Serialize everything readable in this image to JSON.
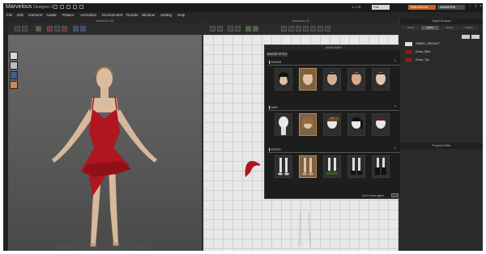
{
  "app": {
    "logo_text": "Marvelous",
    "logo_suffix": "Designer 3",
    "version": "1.1.79",
    "field_value": "Full Imported",
    "mode_simulation": "SIMULATION",
    "mode_animation": "ANIMATION"
  },
  "menu": [
    "File",
    "Edit",
    "Garment",
    "Avatar",
    "Pattern",
    "Animation",
    "Environment",
    "Render",
    "Window",
    "Setting",
    "Help"
  ],
  "viewport3d": {
    "title": "Marvelous 3D"
  },
  "viewport2d": {
    "title": "Marvelous 2D"
  },
  "object_browser": {
    "title": "Object Browser",
    "tabs": [
      "Scene",
      "Fabric",
      "Button",
      "Texture"
    ],
    "active_tab": "Fabric",
    "fabrics": [
      {
        "name": "FABRIC_DEFAULT",
        "color": "#e0e0e0"
      },
      {
        "name": "Dress_Skirt",
        "color": "#8b1a1a"
      },
      {
        "name": "Dress_Top",
        "color": "#8b1a1a"
      }
    ]
  },
  "property_editor": {
    "title": "Property Editor"
  },
  "avatar_editor": {
    "title": "Avatar Editor",
    "tab": "AVATAR STYLE",
    "sections": [
      {
        "label": "▌AVATAR",
        "items": 5,
        "selected": 1
      },
      {
        "label": "▌HAIR",
        "items": 5,
        "selected": 1
      },
      {
        "label": "▌SHOES",
        "items": 5,
        "selected": 1
      }
    ],
    "dont_show": "Don't show again"
  },
  "colors": {
    "accent": "#c8641e",
    "dress": "#b01520",
    "selected_thumb": "#7b6242"
  }
}
